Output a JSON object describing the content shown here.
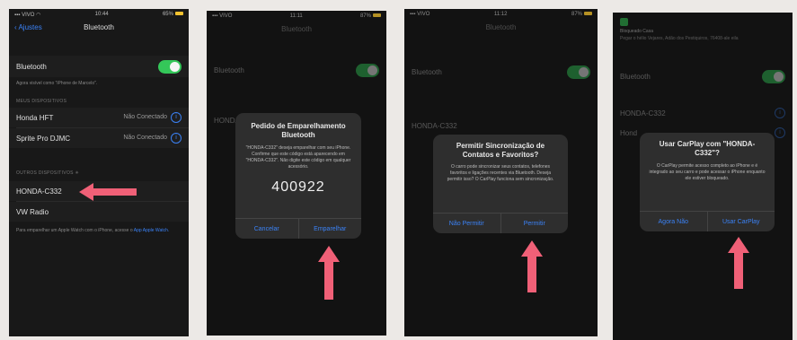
{
  "panel1": {
    "carrier": "VIVO",
    "time": "10:44",
    "battery": "65%",
    "back_label": "Ajustes",
    "title": "Bluetooth",
    "bt_label": "Bluetooth",
    "bt_note": "Agora visível como \"iPhone de Marcelo\".",
    "my_devices_header": "MEUS DISPOSITIVOS",
    "devices": [
      {
        "name": "Honda HFT",
        "status": "Não Conectado"
      },
      {
        "name": "Sprite Pro DJMC",
        "status": "Não Conectado"
      }
    ],
    "other_devices_header": "OUTROS DISPOSITIVOS",
    "other_devices": [
      "HONDA-C332",
      "VW Radio"
    ],
    "footer_note": "Para emparelhar um Apple Watch com o iPhone, acesse o",
    "footer_link": "App Apple Watch."
  },
  "panel2": {
    "carrier": "VIVO",
    "time": "11:11",
    "battery": "87%",
    "title": "Bluetooth",
    "bt_label": "Bluetooth",
    "bg_device": "HONDA-C332",
    "alert_title": "Pedido de Emparelhamento Bluetooth",
    "alert_message": "\"HONDA-C332\" deseja emparelhar com seu iPhone. Confirme que este código está aparecendo em \"HONDA-C332\". Não digite este código em qualquer acessório.",
    "code": "400922",
    "cancel": "Cancelar",
    "pair": "Emparelhar"
  },
  "panel3": {
    "carrier": "VIVO",
    "time": "11:12",
    "battery": "87%",
    "title": "Bluetooth",
    "bt_label": "Bluetooth",
    "bg_device": "HONDA-C332",
    "alert_title": "Permitir Sincronização de Contatos e Favoritos?",
    "alert_message": "O carro pode sincronizar seus contatos, telefones favoritos e ligações recentes via Bluetooth. Deseja permitir isso? O CarPlay funciona sem sincronização.",
    "deny": "Não Permitir",
    "allow": "Permitir"
  },
  "panel4": {
    "header_text": "Bloqueado Casa",
    "header_sub": "Pegar o hélio Vejares, Adão dos Pestiquiros, 76408-ale eila",
    "bt_label": "Bluetooth",
    "bg_device": "HONDA-C332",
    "bg_device2": "Hond",
    "alert_title": "Usar CarPlay com \"HONDA-C332\"?",
    "alert_message": "O CarPlay permite acesso completo ao iPhone e é integrado ao seu carro e pode acessar o iPhone enquanto ele estiver bloqueado.",
    "not_now": "Agora Não",
    "use": "Usar CarPlay"
  },
  "colors": {
    "accent": "#3b82f6",
    "toggle": "#34c759",
    "arrow": "#f06077"
  }
}
